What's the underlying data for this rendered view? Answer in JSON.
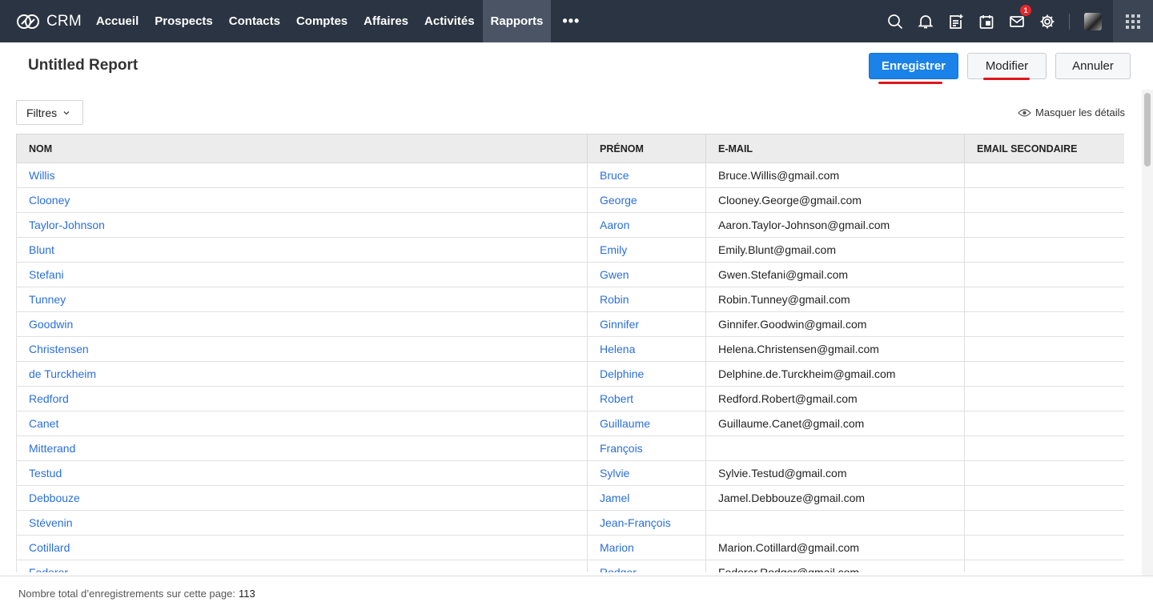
{
  "nav": {
    "brand": "CRM",
    "items": [
      "Accueil",
      "Prospects",
      "Contacts",
      "Comptes",
      "Affaires",
      "Activités",
      "Rapports"
    ],
    "active": "Rapports",
    "more": "•••",
    "notification_count": "1",
    "icons": [
      "search-icon",
      "bell-icon",
      "note-add-icon",
      "calendar-icon",
      "mail-icon",
      "gear-icon",
      "avatar",
      "apps-grid-icon"
    ]
  },
  "header": {
    "title": "Untitled Report",
    "save_label": "Enregistrer",
    "edit_label": "Modifier",
    "cancel_label": "Annuler"
  },
  "toolbar": {
    "filters_label": "Filtres",
    "hide_details_label": "Masquer les détails"
  },
  "table": {
    "columns": [
      "NOM",
      "PRÉNOM",
      "E-MAIL",
      "EMAIL SECONDAIRE"
    ],
    "rows": [
      [
        "Willis",
        "Bruce",
        "Bruce.Willis@gmail.com",
        ""
      ],
      [
        "Clooney",
        "George",
        "Clooney.George@gmail.com",
        ""
      ],
      [
        "Taylor-Johnson",
        "Aaron",
        "Aaron.Taylor-Johnson@gmail.com",
        ""
      ],
      [
        "Blunt",
        "Emily",
        "Emily.Blunt@gmail.com",
        ""
      ],
      [
        "Stefani",
        "Gwen",
        "Gwen.Stefani@gmail.com",
        ""
      ],
      [
        "Tunney",
        "Robin",
        "Robin.Tunney@gmail.com",
        ""
      ],
      [
        "Goodwin",
        "Ginnifer",
        "Ginnifer.Goodwin@gmail.com",
        ""
      ],
      [
        "Christensen",
        "Helena",
        "Helena.Christensen@gmail.com",
        ""
      ],
      [
        "de Turckheim",
        "Delphine",
        "Delphine.de.Turckheim@gmail.com",
        ""
      ],
      [
        "Redford",
        "Robert",
        "Redford.Robert@gmail.com",
        ""
      ],
      [
        "Canet",
        "Guillaume",
        "Guillaume.Canet@gmail.com",
        ""
      ],
      [
        "Mitterand",
        "François",
        "",
        ""
      ],
      [
        "Testud",
        "Sylvie",
        "Sylvie.Testud@gmail.com",
        ""
      ],
      [
        "Debbouze",
        "Jamel",
        "Jamel.Debbouze@gmail.com",
        ""
      ],
      [
        "Stévenin",
        "Jean-François",
        "",
        ""
      ],
      [
        "Cotillard",
        "Marion",
        "Marion.Cotillard@gmail.com",
        ""
      ],
      [
        "Federer",
        "Rodger",
        "Federer.Rodger@gmail.com",
        ""
      ]
    ]
  },
  "footer": {
    "label": "Nombre total d’enregistrements sur cette page:",
    "count": "113"
  },
  "colors": {
    "topbar": "#2b3442",
    "accent": "#1a82e8",
    "link": "#2a6fdb",
    "highlight": "#e0161b"
  }
}
